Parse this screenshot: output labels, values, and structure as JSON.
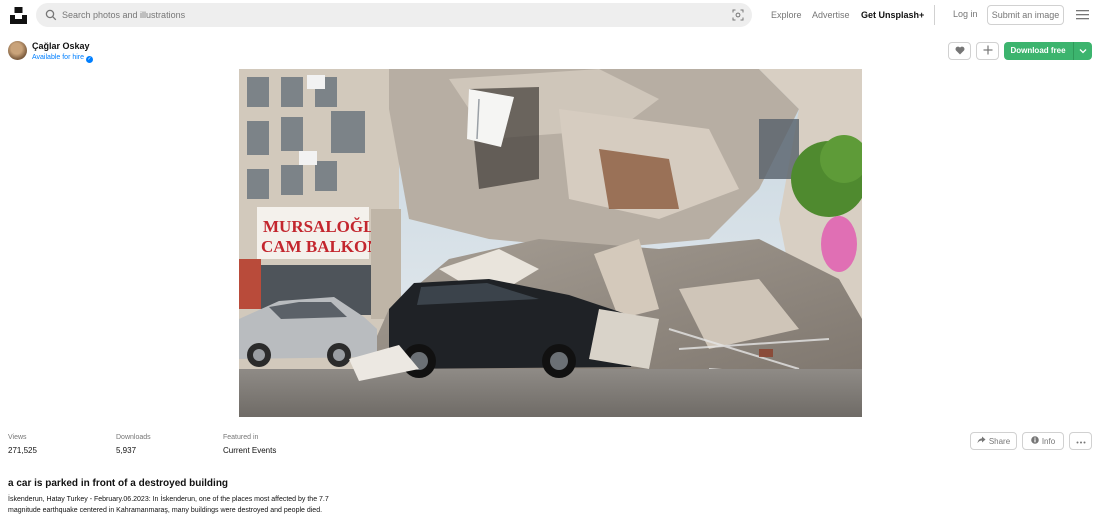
{
  "header": {
    "search_placeholder": "Search photos and illustrations",
    "nav": {
      "explore": "Explore",
      "advertise": "Advertise",
      "get_plus": "Get Unsplash+"
    },
    "login": "Log in",
    "submit": "Submit an image"
  },
  "photographer": {
    "name": "Çağlar Oskay",
    "status": "Available for hire"
  },
  "actions": {
    "download": "Download free"
  },
  "stats": {
    "views_label": "Views",
    "views_value": "271,525",
    "downloads_label": "Downloads",
    "downloads_value": "5,937",
    "featured_label": "Featured in",
    "featured_value": "Current Events"
  },
  "side_actions": {
    "share": "Share",
    "info": "Info"
  },
  "photo": {
    "title": "a car is parked in front of a destroyed building",
    "description": "İskenderun, Hatay Turkey - February.06.2023: In İskenderun, one of the places most affected by the 7.7 magnitude earthquake centered in Kahramanmaraş, many buildings were destroyed and people died.",
    "sign_line1": "MURSALOĞLU",
    "sign_line2": "CAM BALKON"
  },
  "colors": {
    "brand_green": "#3cb46e",
    "link_blue": "#007fff",
    "muted_text": "#767676"
  }
}
